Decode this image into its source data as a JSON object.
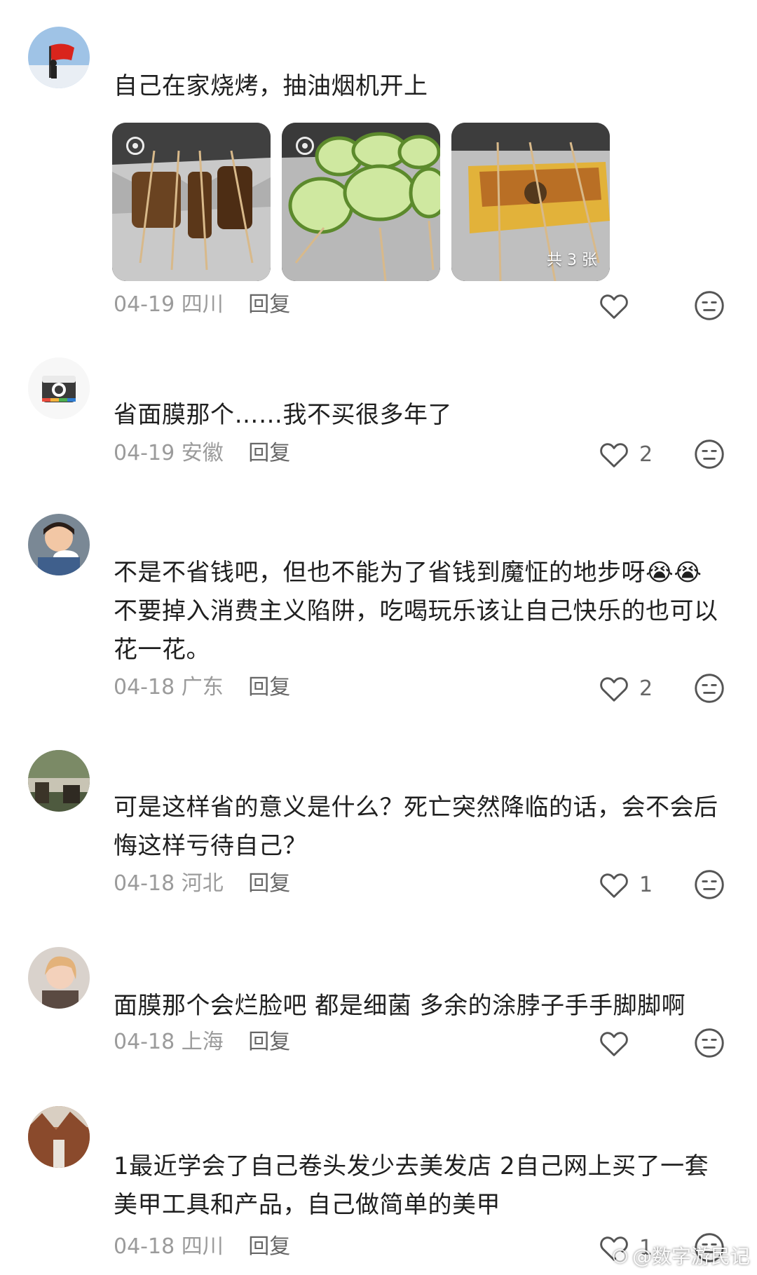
{
  "comments": [
    {
      "username": "",
      "text": "自己在家烧烤，抽油烟机开上",
      "date": "04-19",
      "location": "四川",
      "reply_label": "回复",
      "likes": "",
      "images": {
        "count_label": "共 3 张"
      }
    },
    {
      "username": "",
      "text": "省面膜那个……我不买很多年了",
      "date": "04-19",
      "location": "安徽",
      "reply_label": "回复",
      "likes": "2"
    },
    {
      "username": "",
      "text": "不是不省钱吧，但也不能为了省钱到魔怔的地步呀😭😭\n不要掉入消费主义陷阱，吃喝玩乐该让自己快乐的也可以花一花。",
      "date": "04-18",
      "location": "广东",
      "reply_label": "回复",
      "likes": "2"
    },
    {
      "username": "",
      "text": "可是这样省的意义是什么？死亡突然降临的话，会不会后悔这样亏待自己？",
      "date": "04-18",
      "location": "河北",
      "reply_label": "回复",
      "likes": "1"
    },
    {
      "username": "",
      "text": "面膜那个会烂脸吧 都是细菌 多余的涂脖子手手脚脚啊",
      "date": "04-18",
      "location": "上海",
      "reply_label": "回复",
      "likes": ""
    },
    {
      "username": "",
      "text": "1最近学会了自己卷头发少去美发店 2自己网上买了一套美甲工具和产品，自己做简单的美甲",
      "date": "04-18",
      "location": "四川",
      "reply_label": "回复",
      "likes": "1"
    }
  ],
  "watermark": "@数字游民记",
  "icons": {
    "like": "heart-outline-icon",
    "dislike": "neutral-face-icon"
  },
  "colors": {
    "text": "#1f1f1f",
    "meta": "#9b9b9b",
    "icon": "#555555"
  }
}
